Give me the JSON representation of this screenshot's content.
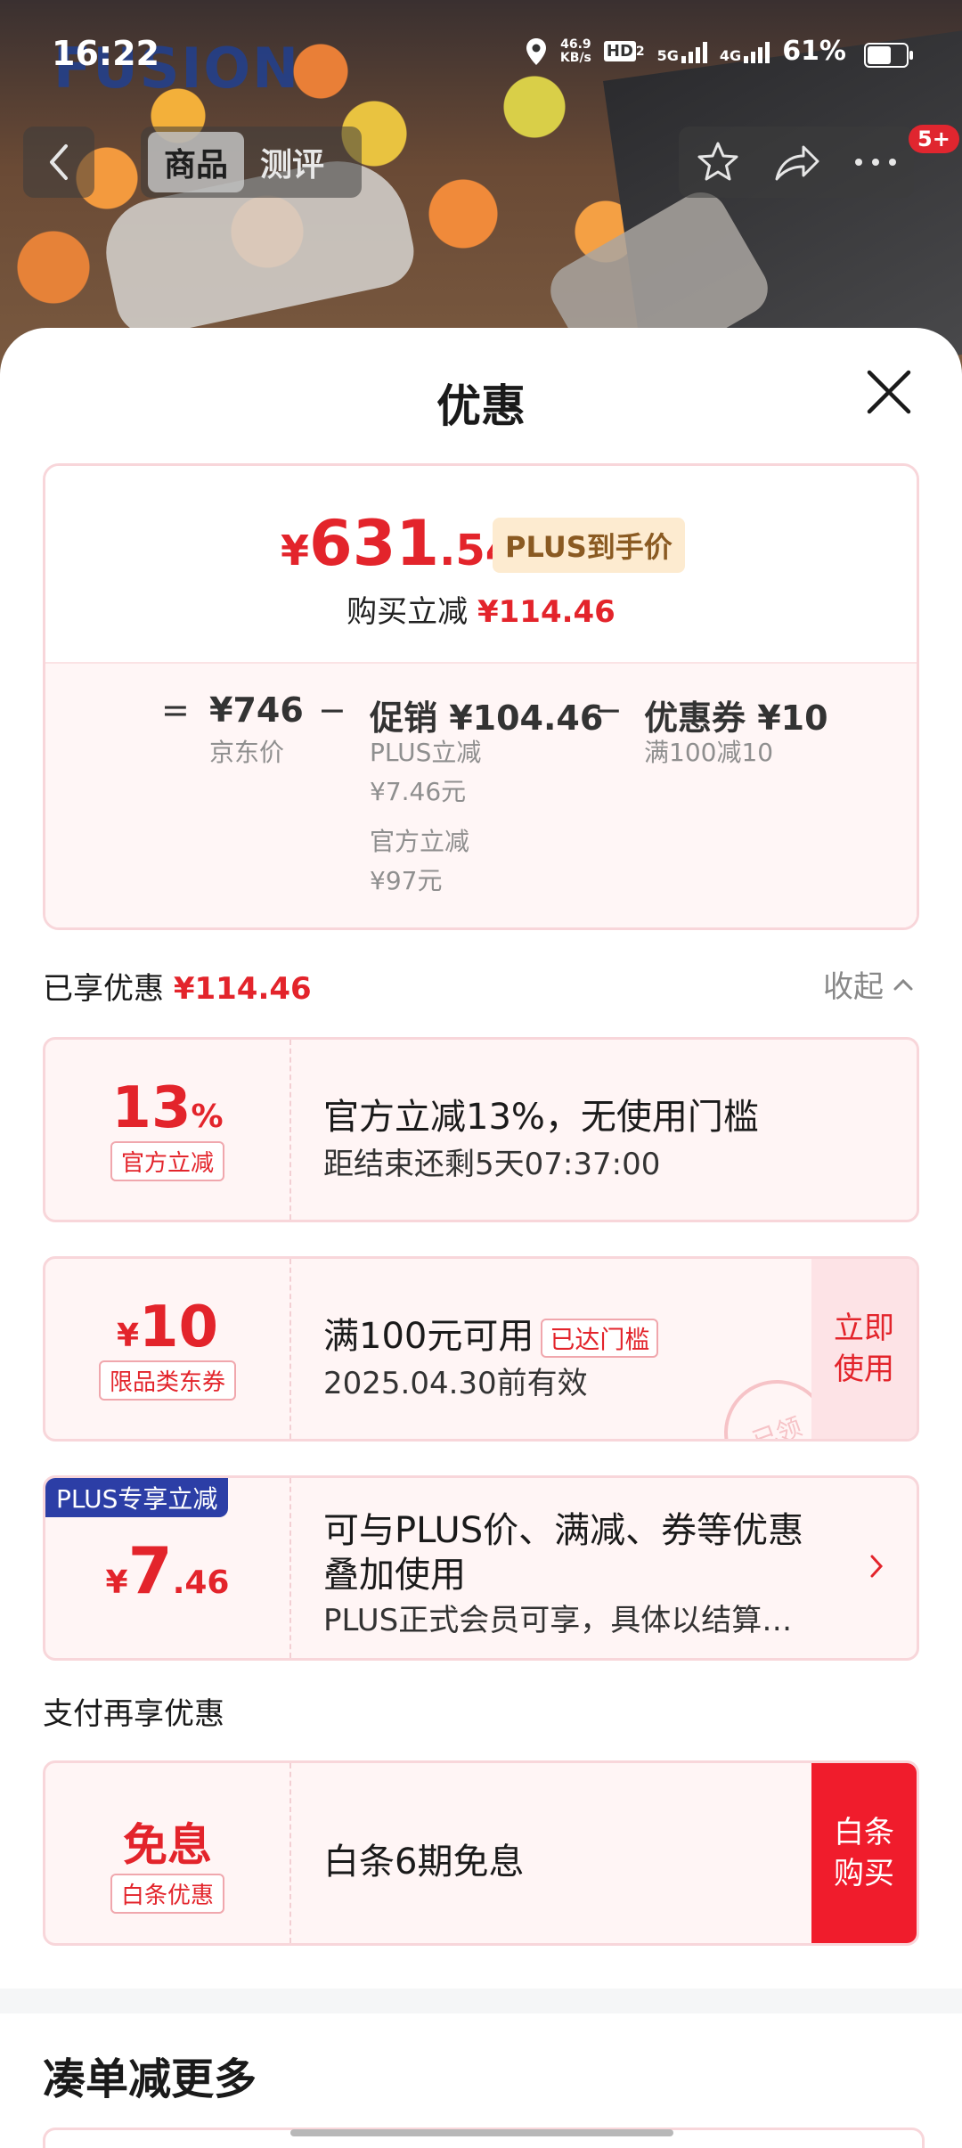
{
  "status_bar": {
    "time": "16:22",
    "net_speed_value": "46.9",
    "net_speed_unit": "KB/s",
    "hd_label": "HD",
    "hd_sub": "2",
    "sig1_label": "5G",
    "sig2_label": "4G",
    "battery": "61%"
  },
  "hero": {
    "brand_watermark": "FUSION"
  },
  "nav": {
    "tabs": [
      {
        "label": "商品",
        "active": true
      },
      {
        "label": "测评",
        "active": false
      }
    ],
    "badge": "5+"
  },
  "sheet": {
    "title": "优惠"
  },
  "summary": {
    "final_price_symbol": "¥",
    "final_price_int": "631",
    "final_price_dec": ".54",
    "plus_tag": "PLUS到手价",
    "buy_reduce_label": "购买立减",
    "buy_reduce_amount": "¥114.46",
    "formula": {
      "equals": "=",
      "jd_price": "¥746",
      "jd_price_label": "京东价",
      "minus1": "−",
      "promo": "促销 ¥104.46",
      "promo_detail_1": "PLUS立减",
      "promo_detail_2": "¥7.46元",
      "promo_detail_3": "官方立减",
      "promo_detail_4": "¥97元",
      "minus2": "−",
      "coupon": "优惠券 ¥10",
      "coupon_detail": "满100减10"
    }
  },
  "enjoyed": {
    "label": "已享优惠",
    "amount": "¥114.46",
    "collapse_label": "收起"
  },
  "coupons": [
    {
      "value_main": "13",
      "value_unit": "%",
      "tag": "官方立减",
      "title": "官方立减13%，无使用门槛",
      "subtitle": "距结束还剩5天07:37:00"
    },
    {
      "value_symbol": "¥",
      "value_main": "10",
      "tag": "限品类东券",
      "title": "满100元可用",
      "reached_tag": "已达门槛",
      "subtitle": "2025.04.30前有效",
      "action": "立即使用",
      "action_line1": "立即",
      "action_line2": "使用",
      "stamp": "已领"
    },
    {
      "corner": "PLUS专享立减",
      "value_symbol": "¥",
      "value_main": "7",
      "value_dec": ".46",
      "title_line1": "可与PLUS价、满减、券等优惠",
      "title_line2": "叠加使用",
      "subtitle": "PLUS正式会员可享，具体以结算…"
    }
  ],
  "pay_section": {
    "label": "支付再享优惠",
    "card": {
      "value": "免息",
      "tag": "白条优惠",
      "title": "白条6期免息",
      "action_line1": "白条",
      "action_line2": "购买"
    }
  },
  "more": {
    "title": "凑单减更多"
  },
  "colors": {
    "accent_red": "#e3242b",
    "plus_blue": "#2c3ea6",
    "buy_red": "#f01c2c",
    "card_border": "#f8d6da",
    "card_bg": "#fff5f5"
  },
  "icons": [
    "location-icon",
    "back-arrow-icon",
    "star-icon",
    "share-icon",
    "more-dots-icon",
    "close-icon",
    "chevron-up-icon",
    "chevron-right-icon"
  ]
}
